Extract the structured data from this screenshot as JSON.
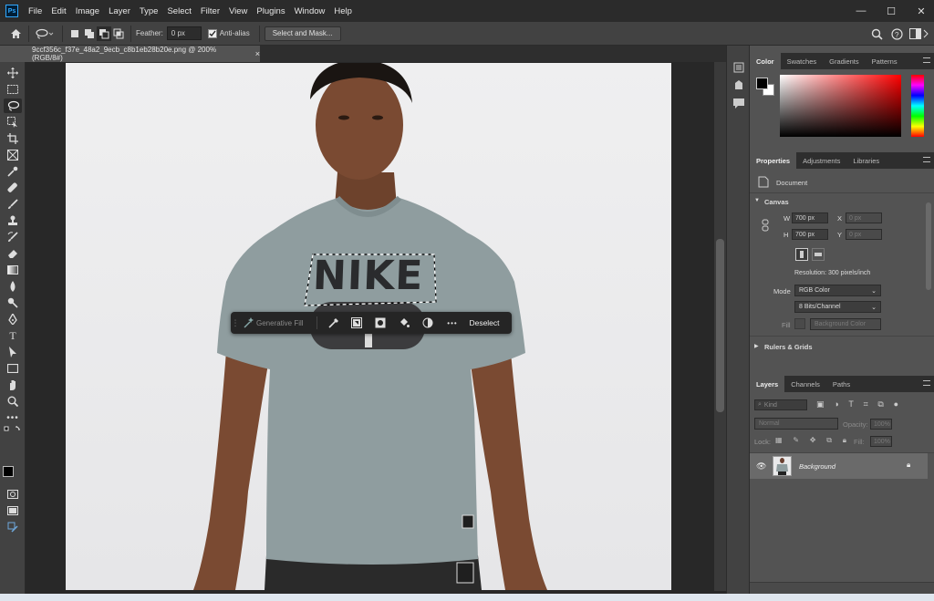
{
  "menubar": {
    "logo": "Ps",
    "items": [
      "File",
      "Edit",
      "Image",
      "Layer",
      "Type",
      "Select",
      "Filter",
      "View",
      "Plugins",
      "Window",
      "Help"
    ]
  },
  "optionsbar": {
    "feather_label": "Feather:",
    "feather_value": "0 px",
    "antialias_label": "Anti-alias",
    "select_mask_label": "Select and Mask..."
  },
  "document": {
    "tab_title": "9ccf356c_f37e_48a2_9ecb_c8b1eb28b20e.png @ 200% (RGB/8#)",
    "close_glyph": "×",
    "shirt_text": "NIKE"
  },
  "taskbar_ctx": {
    "generative_fill": "Generative Fill",
    "more": "•••",
    "deselect": "Deselect"
  },
  "color_panel": {
    "tabs": [
      "Color",
      "Swatches",
      "Gradients",
      "Patterns"
    ],
    "foreground": "#000000",
    "background": "#ffffff"
  },
  "properties_panel": {
    "tabs": [
      "Properties",
      "Adjustments",
      "Libraries"
    ],
    "doc_label": "Document",
    "canvas_section": "Canvas",
    "w_label": "W",
    "w_value": "700 px",
    "h_label": "H",
    "h_value": "700 px",
    "x_label": "X",
    "x_value": "0 px",
    "y_label": "Y",
    "y_value": "0 px",
    "resolution": "Resolution: 300 pixels/inch",
    "mode_label": "Mode",
    "mode_value": "RGB Color",
    "bits_value": "8 Bits/Channel",
    "fill_label": "Fill",
    "fill_value": "Background Color",
    "rulers_section": "Rulers & Grids"
  },
  "layers_panel": {
    "tabs": [
      "Layers",
      "Channels",
      "Paths"
    ],
    "kind_placeholder": "Kind",
    "blend_mode": "Normal",
    "opacity_label": "Opacity:",
    "opacity_value": "100%",
    "lock_label": "Lock:",
    "fill_label": "Fill:",
    "fill_value": "100%",
    "layer_name": "Background"
  }
}
